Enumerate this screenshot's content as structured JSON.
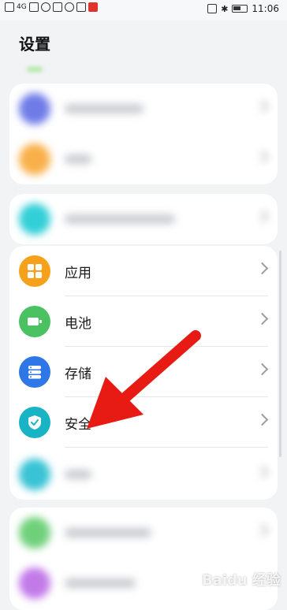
{
  "status_bar": {
    "time": "11:06",
    "network_label": "4G",
    "icons": [
      "hd-icon",
      "signal-icon",
      "wifi-icon",
      "usb-icon",
      "notification-icon",
      "image-icon",
      "app-badge-icon",
      "nfc-icon",
      "bluetooth-icon",
      "battery-icon"
    ]
  },
  "page": {
    "title": "设置"
  },
  "menu": {
    "items": [
      {
        "label": "应用",
        "icon": "apps-grid-icon",
        "color": "#f5a11b"
      },
      {
        "label": "电池",
        "icon": "battery-icon",
        "color": "#4ac262"
      },
      {
        "label": "存储",
        "icon": "storage-icon",
        "color": "#2f76e6"
      },
      {
        "label": "安全",
        "icon": "shield-check-icon",
        "color": "#18b4c6"
      }
    ],
    "blurred_colors": [
      "#6f7ce8",
      "#f9b04a",
      "#33cfd8",
      "#39c3d5",
      "#6fd07a",
      "#c27ae8"
    ]
  },
  "watermark": {
    "text": "Baidu 经验"
  },
  "annotation": {
    "arrow_color": "#e81a14"
  }
}
